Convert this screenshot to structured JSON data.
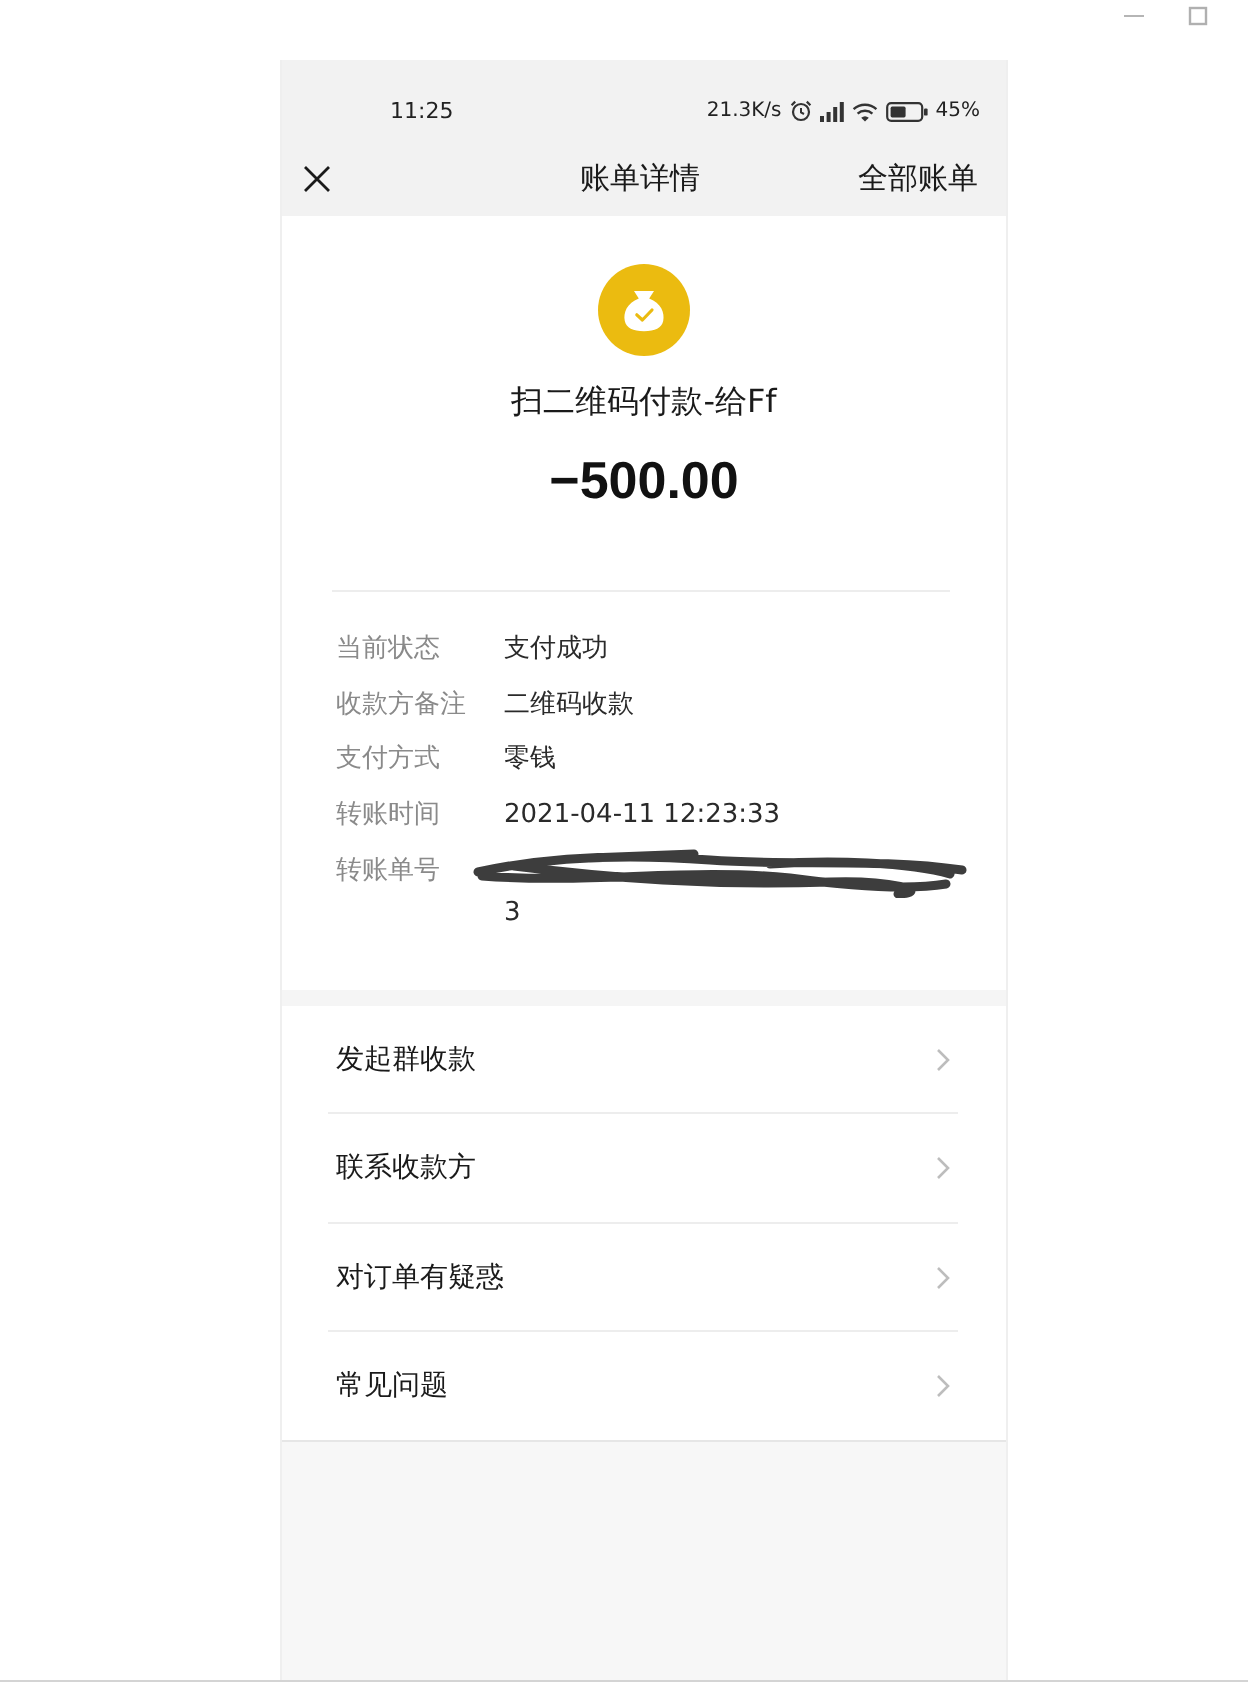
{
  "window_controls": [
    {
      "kind": "minimize"
    },
    {
      "kind": "maximize"
    }
  ],
  "status_bar": {
    "time": "11:25",
    "network_speed": "21.3K/s",
    "battery_text": "45%"
  },
  "nav_bar": {
    "title": "账单详情",
    "action": "全部账单"
  },
  "transaction": {
    "title": "扫二维码付款-给Ff",
    "amount": "−500.00"
  },
  "details": [
    {
      "label": "当前状态",
      "value": "支付成功",
      "redacted": false
    },
    {
      "label": "收款方备注",
      "value": "二维码收款",
      "redacted": false
    },
    {
      "label": "支付方式",
      "value": "零钱",
      "redacted": false
    },
    {
      "label": "转账时间",
      "value": "2021-04-11 12:23:33",
      "redacted": false
    },
    {
      "label": "转账单号",
      "value": "3",
      "redacted": true
    }
  ],
  "actions": [
    {
      "label": "发起群收款"
    },
    {
      "label": "联系收款方"
    },
    {
      "label": "对订单有疑惑"
    },
    {
      "label": "常见问题"
    }
  ]
}
